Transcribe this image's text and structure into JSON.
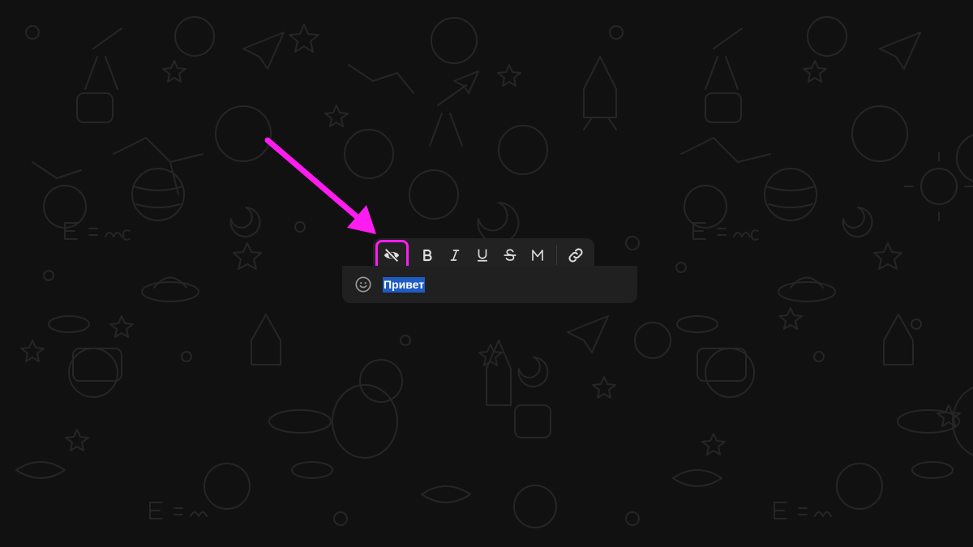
{
  "background": {
    "color": "#111111",
    "pattern": "space-doodles",
    "pattern_color": "#262626"
  },
  "annotation": {
    "arrow_color": "#ff1cf0",
    "target": "spoiler-button"
  },
  "format_toolbar": {
    "buttons": [
      {
        "name": "spoiler-button",
        "icon": "eye-slash-icon",
        "highlighted": true
      },
      {
        "name": "bold-button",
        "icon": "bold-icon"
      },
      {
        "name": "italic-button",
        "icon": "italic-icon"
      },
      {
        "name": "underline-button",
        "icon": "underline-icon"
      },
      {
        "name": "strikethrough-button",
        "icon": "strikethrough-icon"
      },
      {
        "name": "monospace-button",
        "icon": "monospace-icon"
      },
      {
        "name": "link-button",
        "icon": "link-icon"
      }
    ]
  },
  "composer": {
    "emoji_icon": "smile-icon",
    "text": "Привет",
    "selection_color": "#1f5cc2"
  }
}
